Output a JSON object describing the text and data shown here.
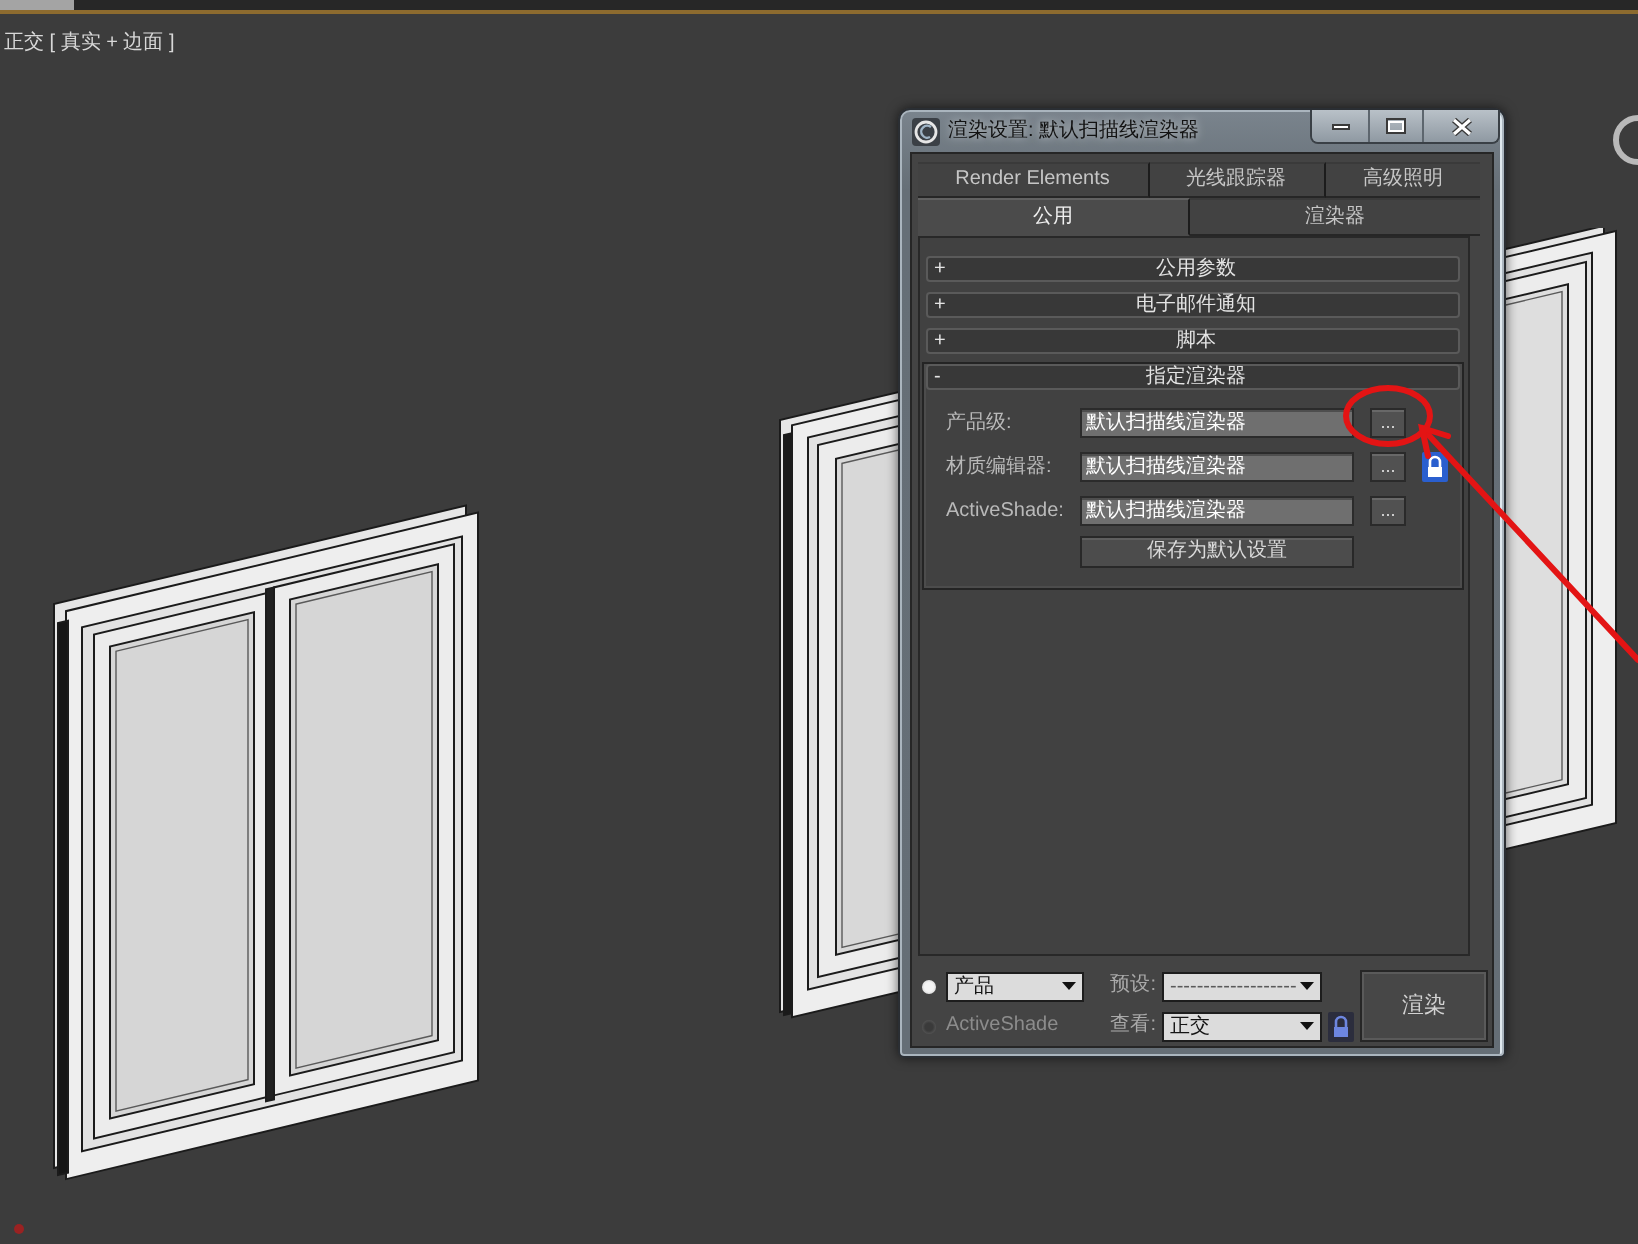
{
  "viewport": {
    "label": "正交 [ 真实 + 边面 ]"
  },
  "dialog": {
    "title": "渲染设置: 默认扫描线渲染器",
    "tab_rows": [
      {
        "tabs": [
          {
            "label": "Render Elements",
            "selected": false
          },
          {
            "label": "光线跟踪器",
            "selected": false
          },
          {
            "label": "高级照明",
            "selected": false
          }
        ]
      },
      {
        "tabs": [
          {
            "label": "公用",
            "selected": true
          },
          {
            "label": "渲染器",
            "selected": false
          }
        ]
      }
    ],
    "rollouts": [
      {
        "sign": "+",
        "title": "公用参数",
        "expanded": false
      },
      {
        "sign": "+",
        "title": "电子邮件通知",
        "expanded": false
      },
      {
        "sign": "+",
        "title": "脚本",
        "expanded": false
      },
      {
        "sign": "-",
        "title": "指定渲染器",
        "expanded": true,
        "rows": [
          {
            "label": "产品级:",
            "value": "默认扫描线渲染器",
            "button": "..."
          },
          {
            "label": "材质编辑器:",
            "value": "默认扫描线渲染器",
            "button": "...",
            "lock": true
          },
          {
            "label": "ActiveShade:",
            "value": "默认扫描线渲染器",
            "button": "..."
          }
        ],
        "save_button": "保存为默认设置"
      }
    ],
    "bottom": {
      "modes": [
        {
          "kind": "dropdown",
          "value": "产品",
          "selected": true
        },
        {
          "kind": "label",
          "label": "ActiveShade",
          "selected": false
        }
      ],
      "preset": {
        "label": "预设:",
        "value": "-------------------"
      },
      "view": {
        "label": "查看:",
        "value": "正交",
        "lock": true
      },
      "render_button": "渲染"
    }
  }
}
